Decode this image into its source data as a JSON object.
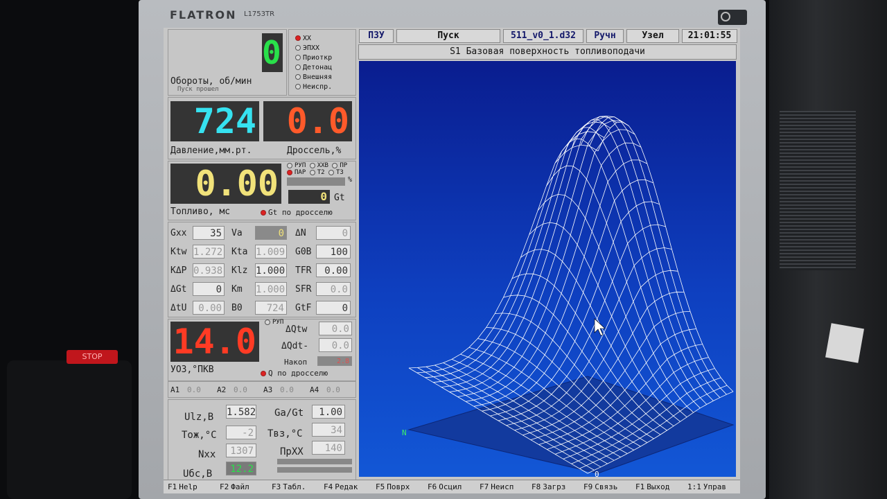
{
  "monitor": {
    "brand": "FLATRON",
    "model": "L1753TR"
  },
  "rpm": {
    "value": "0",
    "label": "Обороты, об/мин",
    "sublabel": "Пуск прошел"
  },
  "modes": [
    {
      "label": "XX",
      "active": true
    },
    {
      "label": "ЭПХХ",
      "active": false
    },
    {
      "label": "Приоткр",
      "active": false
    },
    {
      "label": "Детонац",
      "active": false
    },
    {
      "label": "Внешняя",
      "active": false
    },
    {
      "label": "Неиспр.",
      "active": false
    }
  ],
  "pressure": {
    "value": "724",
    "label": "Давление,мм.рт."
  },
  "throttle": {
    "value": "0.0",
    "label": "Дроссель,%"
  },
  "fuel": {
    "value": "0.00",
    "label": "Топливо, мс",
    "sublabel": "Gt по дросселю",
    "opts_row1": [
      "РУП",
      "ХХВ",
      "ПР"
    ],
    "opts_row2": [
      "ПАР",
      "Т2",
      "Т3"
    ],
    "pct_unit": "%",
    "gt_value": "0",
    "gt_label": "Gt"
  },
  "params": [
    [
      {
        "label": "Gxx",
        "value": "35",
        "dim": false
      },
      {
        "label": "Va",
        "value": "0",
        "dim": false
      },
      {
        "label": "ΔN",
        "value": "0",
        "dim": true
      }
    ],
    [
      {
        "label": "Ktw",
        "value": "1.272",
        "dim": true
      },
      {
        "label": "Kta",
        "value": "1.009",
        "dim": true
      },
      {
        "label": "G0B",
        "value": "100",
        "dim": false
      }
    ],
    [
      {
        "label": "KΔP",
        "value": "0.938",
        "dim": true
      },
      {
        "label": "Klz",
        "value": "1.000",
        "dim": false
      },
      {
        "label": "TFR",
        "value": "0.00",
        "dim": false
      }
    ],
    [
      {
        "label": "ΔGt",
        "value": "0",
        "dim": false
      },
      {
        "label": "Km",
        "value": "1.000",
        "dim": true
      },
      {
        "label": "SFR",
        "value": "0.0",
        "dim": true
      }
    ],
    [
      {
        "label": "ΔtU",
        "value": "0.00",
        "dim": true
      },
      {
        "label": "B0",
        "value": "724",
        "dim": true
      },
      {
        "label": "GtF",
        "value": "0",
        "dim": false
      }
    ]
  ],
  "uoz": {
    "value": "14.0",
    "label": "УОЗ,°ПКВ",
    "sublabel": "Q по дросселю",
    "rup": "РУП",
    "dqtw_label": "ΔQtw",
    "dqtw_value": "0.0",
    "dqdt_label": "ΔQdt-",
    "dqdt_value": "0.0",
    "nakop_label": "Накоп",
    "nakop_value": "2.8"
  },
  "a_row": [
    {
      "label": "A1",
      "value": "0.0"
    },
    {
      "label": "A2",
      "value": "0.0"
    },
    {
      "label": "A3",
      "value": "0.0"
    },
    {
      "label": "A4",
      "value": "0.0"
    }
  ],
  "bottom": [
    {
      "label": "Ulz,B",
      "value": "1.582",
      "dim": false
    },
    {
      "label": "Ga/Gt",
      "value": "1.00",
      "dim": false
    },
    {
      "label": "Tож,°C",
      "value": "-2",
      "dim": true
    },
    {
      "label": "Tвз,°C",
      "value": "34",
      "dim": true
    },
    {
      "label": "Nxx",
      "value": "1307",
      "dim": true
    },
    {
      "label": "ПрXX",
      "value": "140",
      "dim": true
    },
    {
      "label": "Uбс,B",
      "value": "12.2",
      "dim": false
    }
  ],
  "status_bar": {
    "mem": "ПЗУ",
    "state": "Пуск",
    "file": "511_v0_1.d32",
    "mode": "Ручн",
    "node": "Узел",
    "time": "21:01:55"
  },
  "plot": {
    "title": "S1 Базовая поверхность топливоподачи",
    "axis_n": "N",
    "axis_origin": "0",
    "mesh_color": "#ffffff",
    "bg_color": "#0e3fbf"
  },
  "fkeys": [
    {
      "key": "F1",
      "label": "Help"
    },
    {
      "key": "F2",
      "label": "Файл"
    },
    {
      "key": "F3",
      "label": "Табл."
    },
    {
      "key": "F4",
      "label": "Редак"
    },
    {
      "key": "F5",
      "label": "Поврх"
    },
    {
      "key": "F6",
      "label": "Осцил"
    },
    {
      "key": "F7",
      "label": "Неисп"
    },
    {
      "key": "F8",
      "label": "Загрз"
    },
    {
      "key": "F9",
      "label": "Связь"
    },
    {
      "key": "F1",
      "label": "Выход"
    },
    {
      "key": "1:1",
      "label": "Управ"
    }
  ],
  "surroundings": {
    "stop_label": "STOP"
  }
}
